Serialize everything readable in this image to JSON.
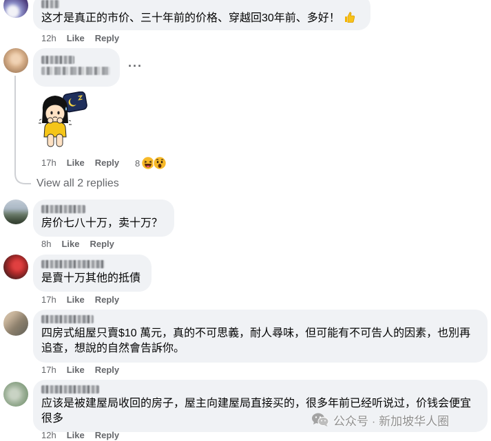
{
  "comments": [
    {
      "text": "这才是真正的市价、三十年前的价格、穿越回30年前、多好！",
      "emoji": "thumbs-up-icon",
      "time": "12h",
      "like": "Like",
      "reply": "Reply"
    },
    {
      "time": "17h",
      "like": "Like",
      "reply": "Reply",
      "more": "···",
      "sticker": "girl-with-pillow-sticker",
      "reactions": {
        "count": "8",
        "types": [
          "haha-icon",
          "wow-icon"
        ]
      }
    },
    {
      "text": "房价七八十万，卖十万？",
      "time": "8h",
      "like": "Like",
      "reply": "Reply"
    },
    {
      "text": "是賣十万其他的抵債",
      "time": "17h",
      "like": "Like",
      "reply": "Reply"
    },
    {
      "text": "四房式組屋只賣$10 萬元，真的不可思義，耐人尋味，但可能有不可告人的因素，也別再追查，想說的自然會告訴你。",
      "time": "17h",
      "like": "Like",
      "reply": "Reply"
    },
    {
      "text": "应该是被建屋局收回的房子，屋主向建屋局直接买的，很多年前已经听说过，价钱会便宜很多",
      "time": "12h",
      "like": "Like",
      "reply": "Reply"
    }
  ],
  "view_replies": "View all 2 replies",
  "watermark": {
    "icon": "wechat-icon",
    "text": "公众号 · 新加坡华人圈"
  },
  "colors": {
    "bubble": "#f0f2f5",
    "text": "#050505",
    "meta": "#65676b",
    "thread_line": "#ced0d4"
  }
}
